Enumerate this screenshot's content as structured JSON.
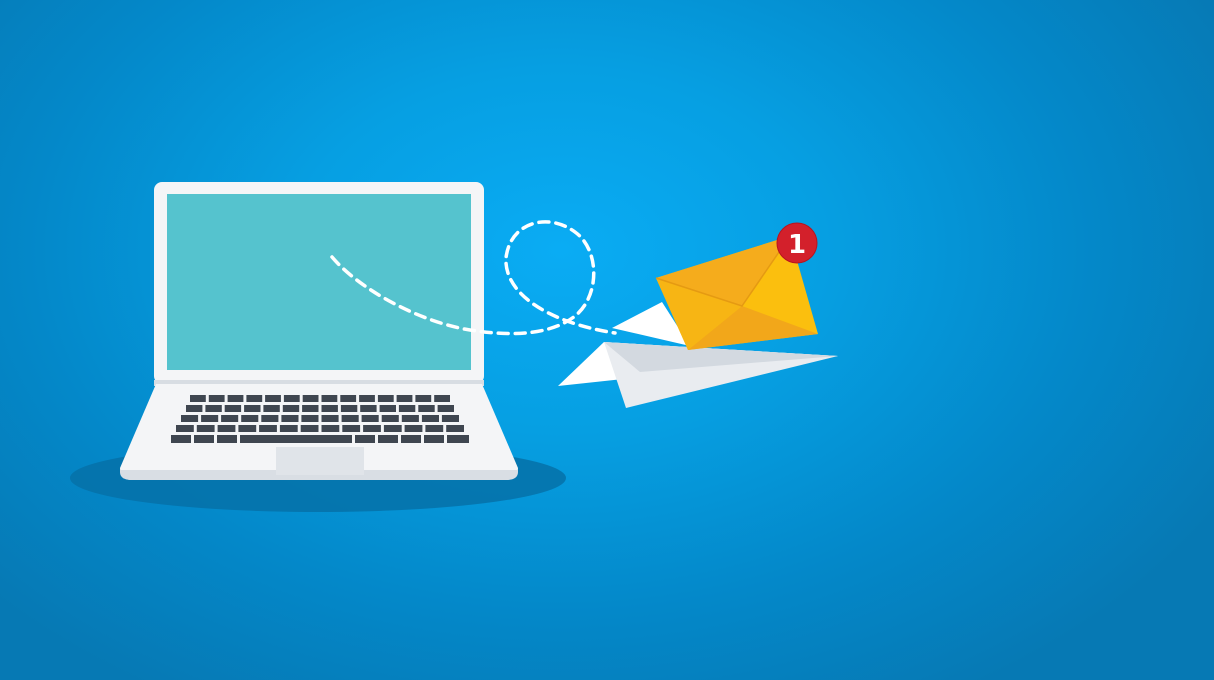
{
  "scene": {
    "description_free": true,
    "colors": {
      "background": "#069fe2",
      "laptop_body": "#f4f5f7",
      "laptop_screen": "#55c3ce",
      "keyboard_keys": "#3f4650",
      "shadow": "#0671a8",
      "envelope_main": "#fbbf0e",
      "envelope_flap": "#f4a91b",
      "paper_plane": "#ffffff",
      "paper_plane_shade": "#dfe3e8",
      "badge": "#d3202b",
      "dash_line": "#ffffff"
    },
    "icons": {
      "laptop": "laptop-icon",
      "paper_plane": "paper-plane-icon",
      "envelope": "envelope-icon",
      "badge": "notification-badge"
    }
  },
  "badge": {
    "count": "1"
  }
}
